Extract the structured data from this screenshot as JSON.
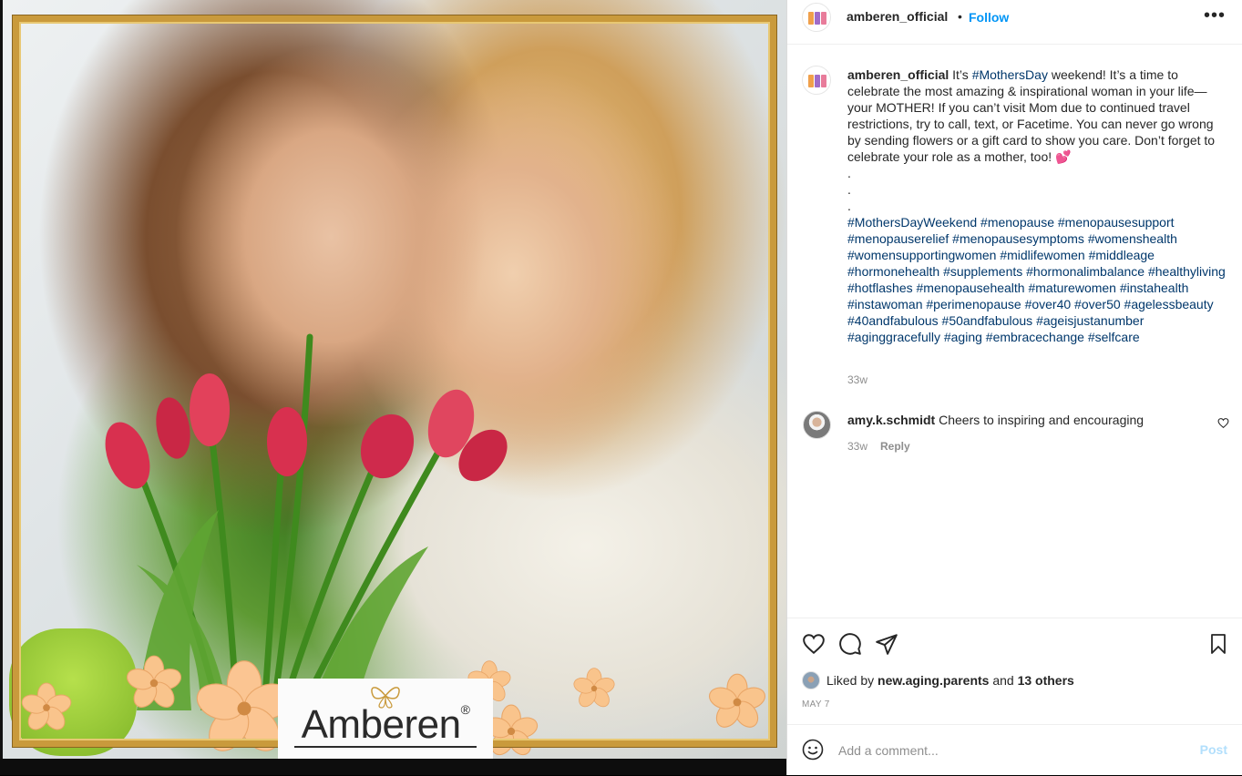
{
  "post": {
    "username": "amberen_official",
    "follow_label": "Follow",
    "separator": "•",
    "more_label": "•••"
  },
  "image": {
    "brand_name": "Amberen",
    "brand_mark": "®"
  },
  "caption": {
    "username": "amberen_official",
    "part1": " It’s ",
    "tag1": "#MothersDay",
    "part2": " weekend! It’s a time to celebrate the most amazing & inspirational woman in your life—your MOTHER! If you can’t visit Mom due to continued travel restrictions, try to call, text, or Facetime. You can never go wrong by sending flowers or a gift card to show you care. Don’t forget to celebrate your role as a mother, too! 💕",
    "dot": ".",
    "hashtags": "#MothersDayWeekend #menopause #menopausesupport #menopauserelief #menopausesymptoms #womenshealth #womensupportingwomen #midlifewomen #middleage #hormonehealth #supplements #hormonalimbalance #healthyliving #hotflashes #menopausehealth #maturewomen #instahealth #instawoman #perimenopause #over40 #over50 #agelessbeauty #40andfabulous #50andfabulous #ageisjustanumber #aginggracefully #aging #embracechange #selfcare",
    "time": "33w"
  },
  "comment": {
    "username": "amy.k.schmidt",
    "text": " Cheers to inspiring and encouraging",
    "time": "33w",
    "reply_label": "Reply"
  },
  "likes": {
    "prefix": "Liked by ",
    "user": "new.aging.parents",
    "middle": " and ",
    "others": "13 others"
  },
  "date": "MAY 7",
  "comment_box": {
    "placeholder": "Add a comment...",
    "post_label": "Post"
  },
  "icons": {
    "like": "heart-icon",
    "comment": "comment-icon",
    "share": "paper-plane-icon",
    "save": "bookmark-icon",
    "emoji": "smiley-icon",
    "more": "more-options-icon"
  },
  "colors": {
    "link_blue": "#0095f6",
    "hashtag": "#00376b",
    "muted": "#8e8e8e",
    "post_disabled": "#b2dffc",
    "frame_gold": "#c99a3c"
  }
}
